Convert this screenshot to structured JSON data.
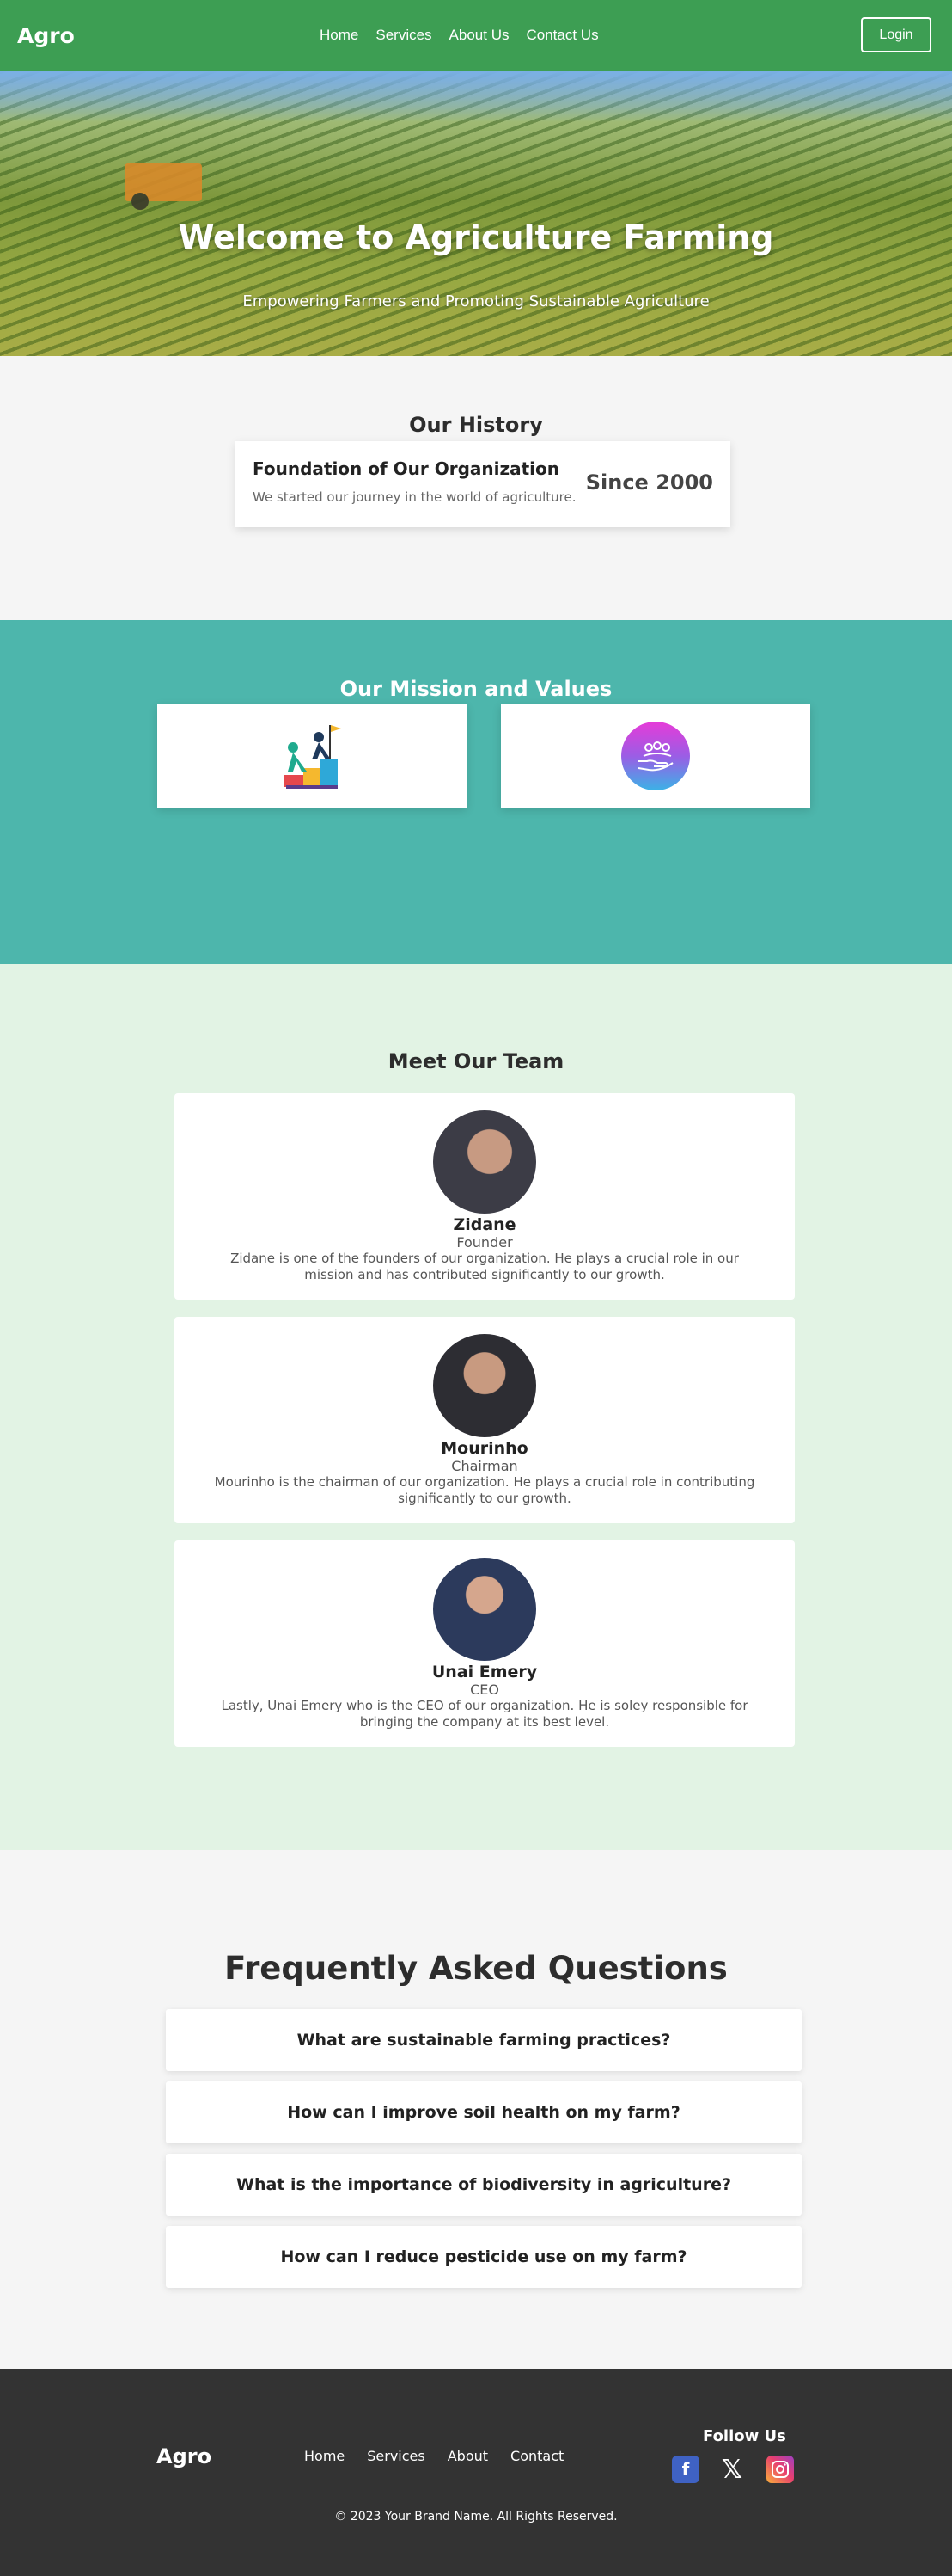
{
  "nav": {
    "brand": "Agro",
    "links": [
      "Home",
      "Services",
      "About Us",
      "Contact Us"
    ],
    "login": "Login"
  },
  "hero": {
    "title": "Welcome to Agriculture Farming",
    "subtitle": "Empowering Farmers and Promoting Sustainable Agriculture"
  },
  "history": {
    "title": "Our History",
    "card_title": "Foundation of Our Organization",
    "card_text": "We started our journey in the world of agriculture.",
    "year": "Since 2000"
  },
  "mission": {
    "title": "Our Mission and Values",
    "icons": [
      "growth-goal-icon",
      "care-hands-icon"
    ]
  },
  "team": {
    "title": "Meet Our Team",
    "members": [
      {
        "name": "Zidane",
        "role": "Founder",
        "desc": "Zidane is one of the founders of our organization. He plays a crucial role in our mission and has contributed significantly to our growth."
      },
      {
        "name": "Mourinho",
        "role": "Chairman",
        "desc": "Mourinho is the chairman of our organization. He plays a crucial role in contributing significantly to our growth."
      },
      {
        "name": "Unai Emery",
        "role": "CEO",
        "desc": "Lastly, Unai Emery who is the CEO of our organization. He is soley responsible for bringing the company at its best level."
      }
    ]
  },
  "faq": {
    "title": "Frequently Asked Questions",
    "items": [
      "What are sustainable farming practices?",
      "How can I improve soil health on my farm?",
      "What is the importance of biodiversity in agriculture?",
      "How can I reduce pesticide use on my farm?"
    ]
  },
  "footer": {
    "brand": "Agro",
    "links": [
      "Home",
      "Services",
      "About",
      "Contact"
    ],
    "follow_title": "Follow Us",
    "social": [
      "facebook-icon",
      "x-icon",
      "instagram-icon"
    ],
    "copyright": "© 2023 Your Brand Name. All Rights Reserved."
  },
  "colors": {
    "nav_green": "#3d9e53",
    "mission_teal": "#4db6ac",
    "team_bg": "#e2f3e4",
    "footer_bg": "#333333"
  }
}
